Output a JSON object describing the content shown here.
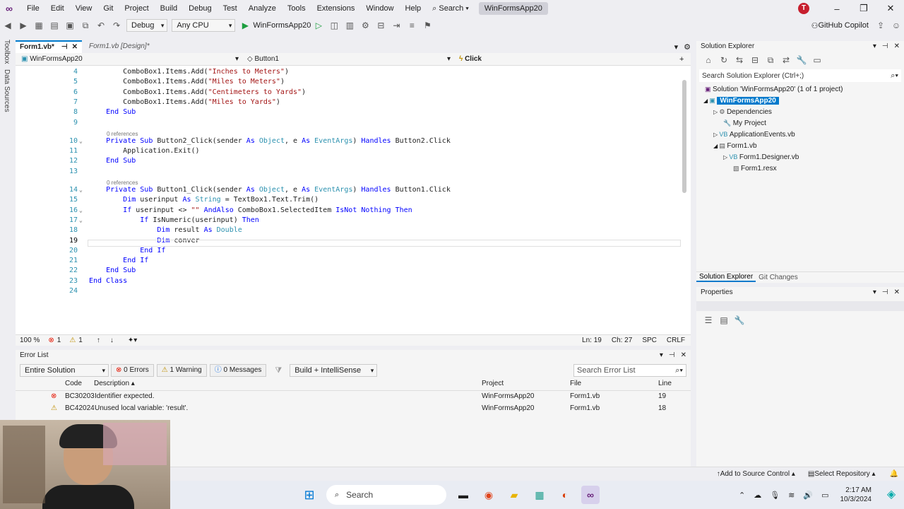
{
  "menu": {
    "items": [
      "File",
      "Edit",
      "View",
      "Git",
      "Project",
      "Build",
      "Debug",
      "Test",
      "Analyze",
      "Tools",
      "Extensions",
      "Window",
      "Help"
    ],
    "search": "Search",
    "solution_title": "WinFormsApp20",
    "avatar_letter": "T"
  },
  "toolbar": {
    "config": "Debug",
    "platform": "Any CPU",
    "run_target": "WinFormsApp20",
    "copilot": "GitHub Copilot"
  },
  "left_strip": [
    "Toolbox",
    "Data Sources"
  ],
  "doc_tabs": [
    {
      "label": "Form1.vb*"
    },
    {
      "label": "Form1.vb [Design]*"
    }
  ],
  "navbar": {
    "project": "WinFormsApp20",
    "object": "Button1",
    "member": "Click"
  },
  "code": {
    "refs": "0 references",
    "lines": [
      {
        "n": "4",
        "t": "        ComboBox1.Items.Add(\"Inches to Meters\")"
      },
      {
        "n": "5",
        "t": "        ComboBox1.Items.Add(\"Miles to Meters\")"
      },
      {
        "n": "6",
        "t": "        ComboBox1.Items.Add(\"Centimeters to Yards\")"
      },
      {
        "n": "7",
        "t": "        ComboBox1.Items.Add(\"Miles to Yards\")"
      },
      {
        "n": "8",
        "t": "    End Sub"
      },
      {
        "n": "9",
        "t": ""
      },
      {
        "n": "10",
        "t": "    Private Sub Button2_Click(sender As Object, e As EventArgs) Handles Button2.Click"
      },
      {
        "n": "11",
        "t": "        Application.Exit()"
      },
      {
        "n": "12",
        "t": "    End Sub"
      },
      {
        "n": "13",
        "t": ""
      },
      {
        "n": "14",
        "t": "    Private Sub Button1_Click(sender As Object, e As EventArgs) Handles Button1.Click"
      },
      {
        "n": "15",
        "t": "        Dim userinput As String = TextBox1.Text.Trim()"
      },
      {
        "n": "16",
        "t": "        If userinput <> \"\" AndAlso ComboBox1.SelectedItem IsNot Nothing Then"
      },
      {
        "n": "17",
        "t": "            If IsNumeric(userinput) Then"
      },
      {
        "n": "18",
        "t": "                Dim result As Double"
      },
      {
        "n": "19",
        "t": "                Dim conver"
      },
      {
        "n": "20",
        "t": "            End If"
      },
      {
        "n": "21",
        "t": "        End If"
      },
      {
        "n": "22",
        "t": "    End Sub"
      },
      {
        "n": "23",
        "t": "End Class"
      },
      {
        "n": "24",
        "t": ""
      }
    ]
  },
  "editor_status": {
    "zoom": "100 %",
    "errors": "1",
    "warnings": "1",
    "position_ln": "Ln: 19",
    "position_ch": "Ch: 27",
    "spacing": "SPC",
    "eol": "CRLF"
  },
  "error_list": {
    "title": "Error List",
    "scope": "Entire Solution",
    "errors_btn": "0 Errors",
    "warnings_btn": "1 Warning",
    "messages_btn": "0 Messages",
    "build_filter": "Build + IntelliSense",
    "search_placeholder": "Search Error List",
    "headers": {
      "code": "Code",
      "description": "Description",
      "project": "Project",
      "file": "File",
      "line": "Line"
    },
    "rows": [
      {
        "type": "error",
        "code": "BC30203",
        "description": "Identifier expected.",
        "project": "WinFormsApp20",
        "file": "Form1.vb",
        "line": "19"
      },
      {
        "type": "warning",
        "code": "BC42024",
        "description": "Unused local variable: 'result'.",
        "project": "WinFormsApp20",
        "file": "Form1.vb",
        "line": "18"
      }
    ]
  },
  "solution_explorer": {
    "title": "Solution Explorer",
    "search_placeholder": "Search Solution Explorer (Ctrl+;)",
    "tree": [
      "Solution 'WinFormsApp20' (1 of 1 project)",
      "WinFormsApp20",
      "Dependencies",
      "My Project",
      "ApplicationEvents.vb",
      "Form1.vb",
      "Form1.Designer.vb",
      "Form1.resx"
    ],
    "tabs": [
      "Solution Explorer",
      "Git Changes"
    ]
  },
  "properties": {
    "title": "Properties"
  },
  "vs_status": {
    "add_source": "Add to Source Control",
    "select_repo": "Select Repository"
  },
  "taskbar": {
    "search": "Search",
    "time": "2:17 AM",
    "date": "10/3/2024"
  }
}
